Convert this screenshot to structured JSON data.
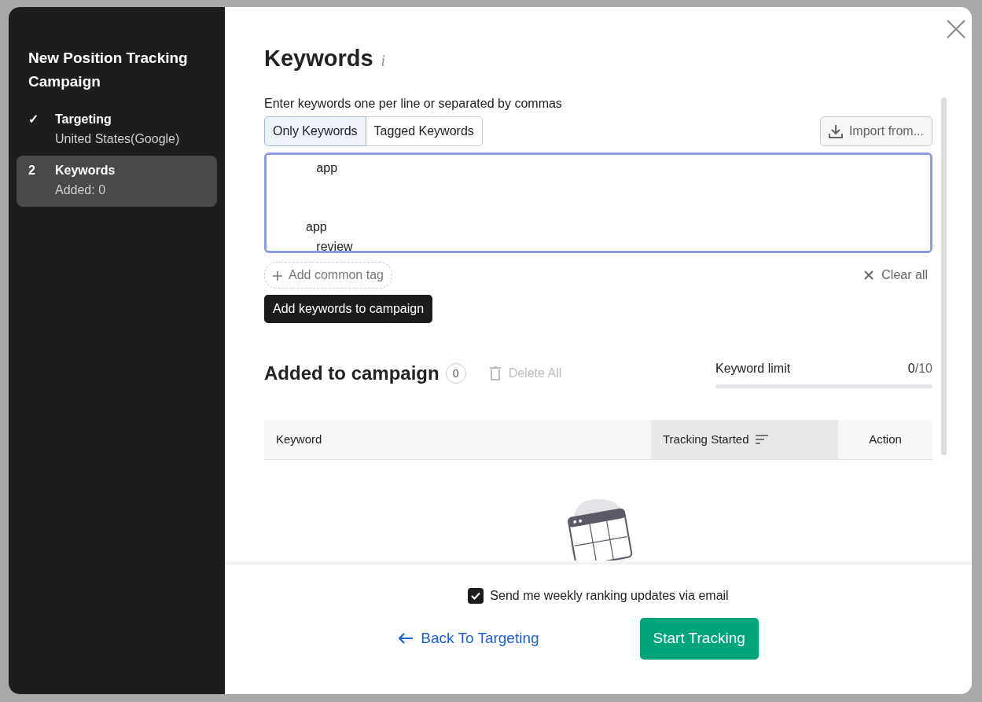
{
  "sidebar": {
    "title": "New Position Tracking Campaign",
    "steps": [
      {
        "marker": "✓",
        "label": "Targeting",
        "detail": "United States(Google)",
        "selected": false
      },
      {
        "marker": "2",
        "label": "Keywords",
        "detail": "Added: 0",
        "selected": true
      }
    ]
  },
  "header": {
    "title": "Keywords",
    "info": "i"
  },
  "keywords_input": {
    "hint": "Enter keywords one per line or separated by commas",
    "tabs": [
      {
        "label": "Only Keywords",
        "selected": true
      },
      {
        "label": "Tagged Keywords",
        "selected": false
      }
    ],
    "import_button": "Import from...",
    "value": "            app\n\n\n         app\n            review",
    "add_tag": "Add common tag",
    "clear": "Clear all",
    "submit": "Add keywords to campaign"
  },
  "added": {
    "title": "Added to campaign",
    "count": "0",
    "delete_all": "Delete All",
    "delete_disabled": true,
    "limit_label": "Keyword limit",
    "limit_used": "0",
    "limit_total": "/10",
    "level": 0,
    "columns": [
      {
        "label": "Keyword",
        "sorted": false
      },
      {
        "label": "Tracking Started",
        "sorted": true
      },
      {
        "label": "Action",
        "sorted": false
      }
    ]
  },
  "footer": {
    "email_updates": {
      "label": "Send me weekly ranking updates via email",
      "checked": true
    },
    "back": "Back To Targeting",
    "start": "Start Tracking"
  }
}
